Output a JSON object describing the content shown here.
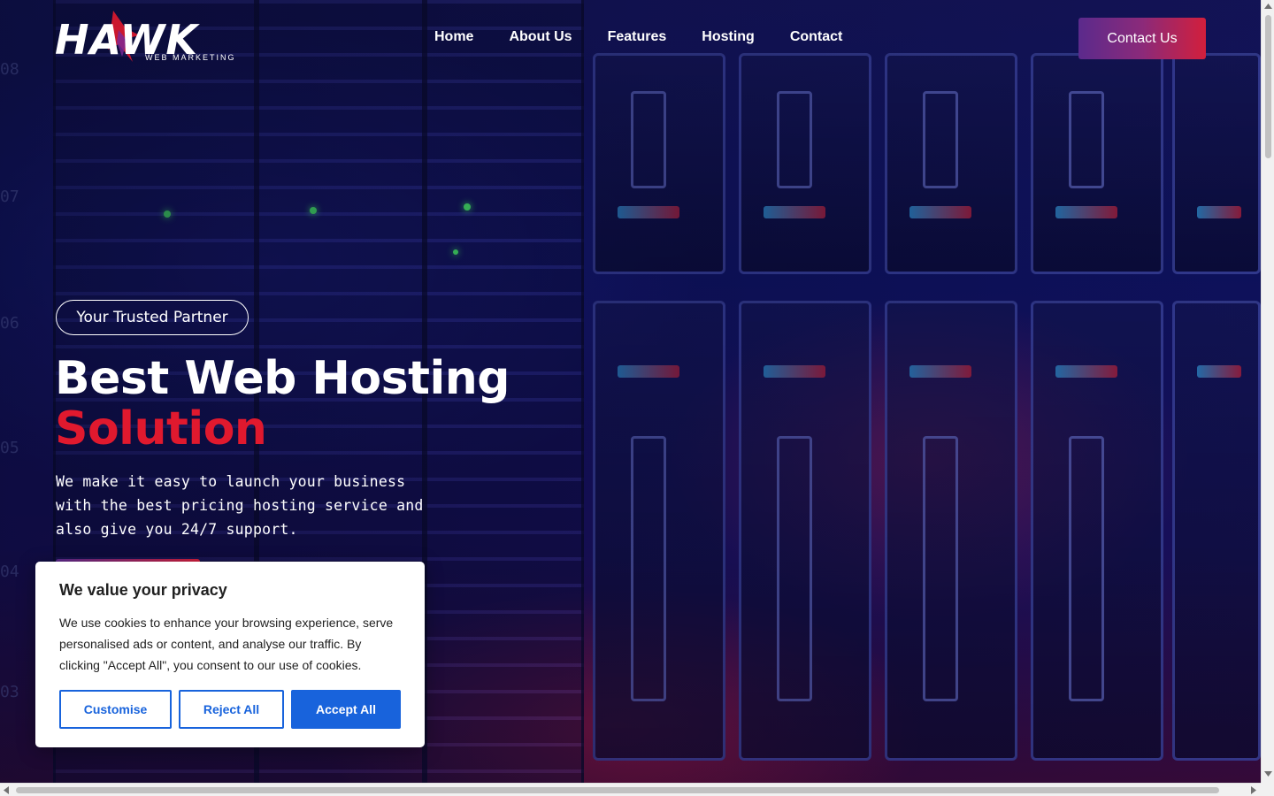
{
  "brand": {
    "logo_text": "HAWK",
    "logo_sub": "WEB MARKETING"
  },
  "nav": {
    "items": [
      "Home",
      "About Us",
      "Features",
      "Hosting",
      "Contact"
    ],
    "contact_button": "Contact Us"
  },
  "hero": {
    "badge": "Your Trusted Partner",
    "title_line1": "Best Web Hosting",
    "title_line2": "Solution",
    "description": "We make it easy to launch your business with the best pricing hosting service and also give you 24/7 support.",
    "accent_color": "#e0192e"
  },
  "background": {
    "rack_numbers": [
      "08",
      "07",
      "06",
      "05",
      "04",
      "03"
    ]
  },
  "cookie_banner": {
    "title": "We value your privacy",
    "text": "We use cookies to enhance your browsing experience, serve personalised ads or content, and analyse our traffic. By clicking \"Accept All\", you consent to our use of cookies.",
    "customise_label": "Customise",
    "reject_label": "Reject All",
    "accept_label": "Accept All",
    "button_color": "#1863dc"
  }
}
